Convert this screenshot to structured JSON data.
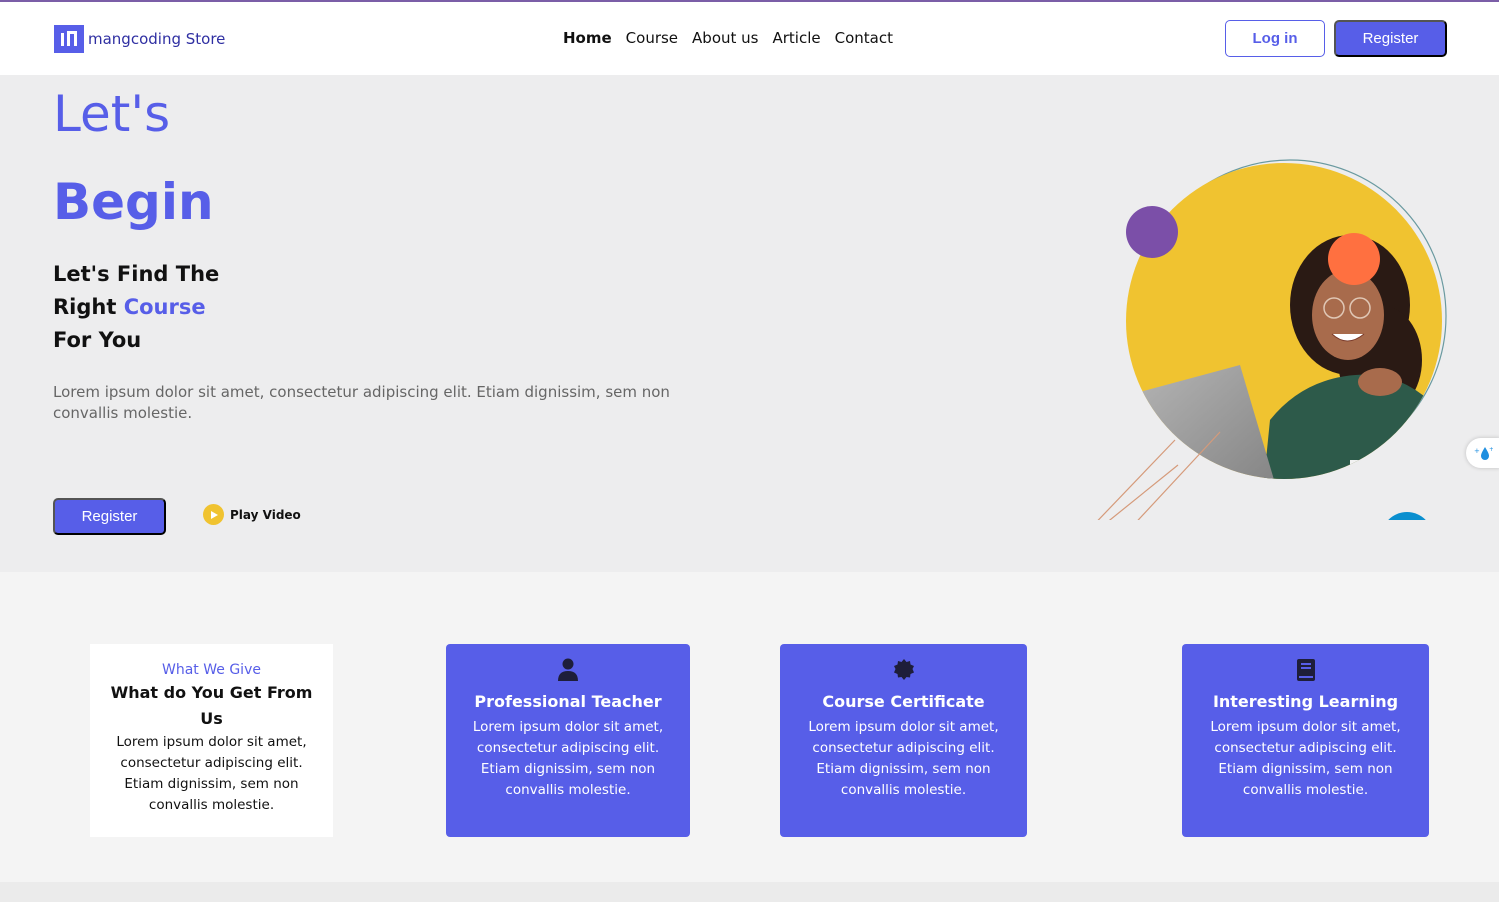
{
  "brand": {
    "logo_text": "ı’|’",
    "name": "mangcoding Store"
  },
  "nav": {
    "items": [
      {
        "label": "Home",
        "active": true
      },
      {
        "label": "Course",
        "active": false
      },
      {
        "label": "About us",
        "active": false
      },
      {
        "label": "Article",
        "active": false
      },
      {
        "label": "Contact",
        "active": false
      }
    ],
    "login_label": "Log in",
    "register_label": "Register"
  },
  "hero": {
    "line1": "Let's",
    "line2": "Begin",
    "sub_line1": "Let's Find The",
    "sub_line2_prefix": "Right ",
    "sub_line2_accent": "Course",
    "sub_line3": "For You",
    "description": "Lorem ipsum dolor sit amet, consectetur adipiscing elit. Etiam dignissim, sem non convallis molestie.",
    "register_label": "Register",
    "play_label": "Play Video"
  },
  "features": {
    "intro": {
      "kicker": "What We Give",
      "title": "What do You Get From Us",
      "text": "Lorem ipsum dolor sit amet, consectetur adipiscing elit. Etiam dignissim, sem non convallis molestie."
    },
    "cards": [
      {
        "icon": "user-icon",
        "title": "Professional Teacher",
        "text": "Lorem ipsum dolor sit amet, consectetur adipiscing elit. Etiam dignissim, sem non convallis molestie."
      },
      {
        "icon": "certificate-icon",
        "title": "Course Certificate",
        "text": "Lorem ipsum dolor sit amet, consectetur adipiscing elit. Etiam dignissim, sem non convallis molestie."
      },
      {
        "icon": "book-icon",
        "title": "Interesting Learning",
        "text": "Lorem ipsum dolor sit amet, consectetur adipiscing elit. Etiam dignissim, sem non convallis molestie."
      }
    ]
  },
  "colors": {
    "accent": "#575ee8",
    "hero_bg": "#ededee",
    "circle_yellow": "#f0c330",
    "circle_purple": "#7b4fa8",
    "circle_orange": "#ff7040",
    "circle_blue": "#0a8fcf"
  }
}
